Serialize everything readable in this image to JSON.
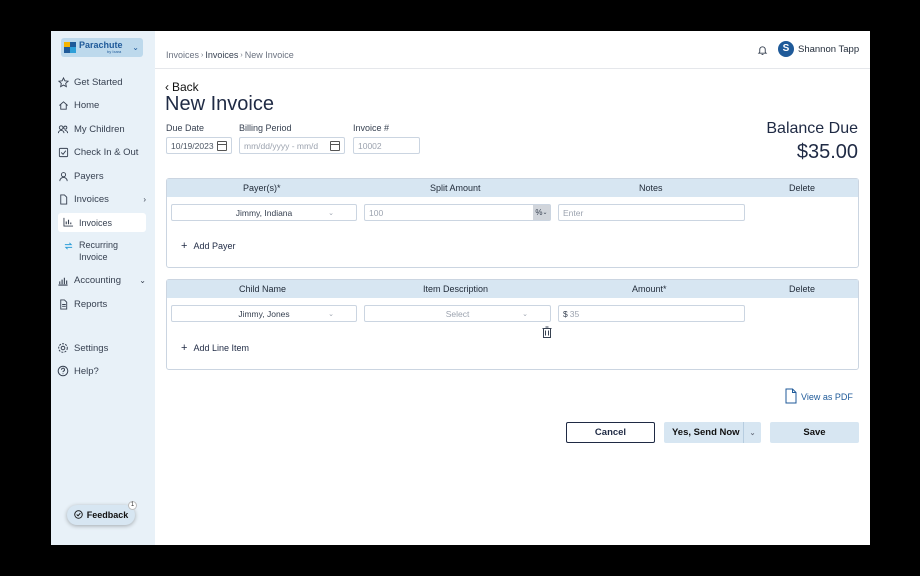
{
  "logo": {
    "name": "Parachute",
    "sub": "by Ixara"
  },
  "sidebar": {
    "items": [
      {
        "label": "Get Started",
        "icon": "star-icon"
      },
      {
        "label": "Home",
        "icon": "home-icon"
      },
      {
        "label": "My Children",
        "icon": "users-icon"
      },
      {
        "label": "Check In & Out",
        "icon": "checkbox-icon"
      },
      {
        "label": "Payers",
        "icon": "user-icon"
      },
      {
        "label": "Invoices",
        "icon": "file-icon"
      },
      {
        "label": "Accounting",
        "icon": "bar-chart-icon"
      },
      {
        "label": "Reports",
        "icon": "document-icon"
      },
      {
        "label": "Settings",
        "icon": "gear-icon"
      },
      {
        "label": "Help?",
        "icon": "help-icon"
      }
    ],
    "sub_items": [
      {
        "label": "Invoices",
        "icon": "chart-icon"
      },
      {
        "label": "Recurring Invoice",
        "icon": "recurring-icon"
      }
    ]
  },
  "feedback": {
    "label": "Feedback",
    "badge": "1"
  },
  "breadcrumb": [
    "Invoices",
    "Invoices",
    "New Invoice"
  ],
  "user": {
    "initial": "S",
    "name": "Shannon Tapp"
  },
  "back_label": "Back",
  "page_title": "New Invoice",
  "form": {
    "due_date": {
      "label": "Due Date",
      "value": "10/19/2023"
    },
    "billing_period": {
      "label": "Billing Period",
      "placeholder": "mm/dd/yyyy - mm/d"
    },
    "invoice_number": {
      "label": "Invoice #",
      "placeholder": "10002"
    }
  },
  "balance": {
    "label": "Balance Due",
    "amount": "$35.00"
  },
  "payers": {
    "headers": [
      "Payer(s)*",
      "Split Amount",
      "Notes",
      "Delete"
    ],
    "row": {
      "payer": "Jimmy, Indiana",
      "split_placeholder": "100",
      "unit": "%",
      "notes_placeholder": "Enter"
    },
    "add_label": "Add Payer"
  },
  "line_items": {
    "headers": [
      "Child Name",
      "Item Description",
      "Amount*",
      "Delete"
    ],
    "row": {
      "child": "Jimmy, Jones",
      "description": "Select",
      "currency": "$",
      "amount_placeholder": "35"
    },
    "add_label": "Add Line Item"
  },
  "view_pdf_label": "View as PDF",
  "buttons": {
    "cancel": "Cancel",
    "send": "Yes, Send Now",
    "save": "Save"
  },
  "colors": {
    "accent": "#1f5a99",
    "header_bg": "#d7e6f2",
    "sidebar_bg": "#e8f1f8"
  }
}
